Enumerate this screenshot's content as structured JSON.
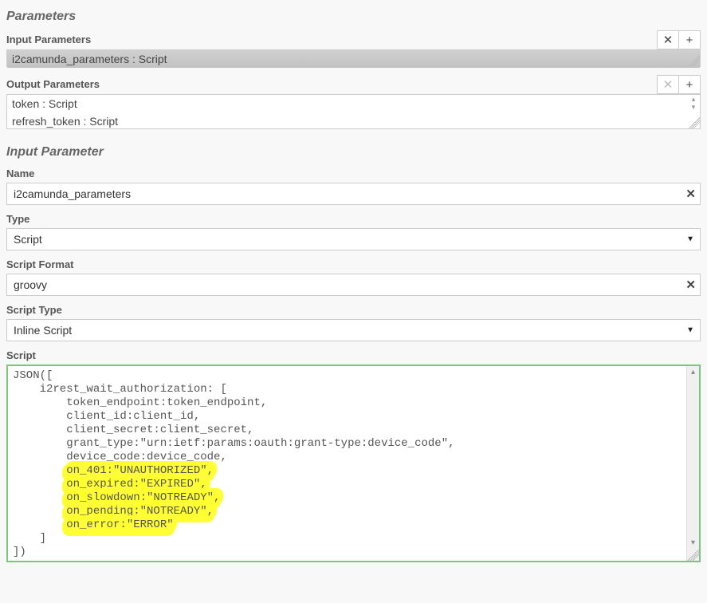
{
  "parameters": {
    "title": "Parameters",
    "input": {
      "label": "Input Parameters",
      "items": [
        "i2camunda_parameters : Script"
      ],
      "selectedIndex": 0,
      "remove_label": "✕",
      "add_label": "+"
    },
    "output": {
      "label": "Output Parameters",
      "items": [
        "token : Script",
        "refresh_token : Script"
      ],
      "remove_label": "✕",
      "add_label": "+"
    }
  },
  "detail": {
    "title": "Input Parameter",
    "name": {
      "label": "Name",
      "value": "i2camunda_parameters"
    },
    "type": {
      "label": "Type",
      "value": "Script"
    },
    "scriptFormat": {
      "label": "Script Format",
      "value": "groovy"
    },
    "scriptType": {
      "label": "Script Type",
      "value": "Inline Script"
    },
    "script": {
      "label": "Script",
      "lines": [
        {
          "indent": 0,
          "text": "JSON(["
        },
        {
          "indent": 1,
          "text": "i2rest_wait_authorization: ["
        },
        {
          "indent": 2,
          "text": "token_endpoint:token_endpoint,"
        },
        {
          "indent": 2,
          "text": "client_id:client_id,"
        },
        {
          "indent": 2,
          "text": "client_secret:client_secret,"
        },
        {
          "indent": 2,
          "text": "grant_type:\"urn:ietf:params:oauth:grant-type:device_code\","
        },
        {
          "indent": 2,
          "text": "device_code:device_code,"
        },
        {
          "indent": 2,
          "text": "on_401:\"UNAUTHORIZED\",",
          "hl": true
        },
        {
          "indent": 2,
          "text": "on_expired:\"EXPIRED\",",
          "hl": true
        },
        {
          "indent": 2,
          "text": "on_slowdown:\"NOTREADY\",",
          "hl": true
        },
        {
          "indent": 2,
          "text": "on_pending:\"NOTREADY\",",
          "hl": true
        },
        {
          "indent": 2,
          "text": "on_error:\"ERROR\"",
          "hl": true
        },
        {
          "indent": 1,
          "text": "]"
        },
        {
          "indent": 0,
          "text": "])"
        }
      ]
    }
  },
  "icons": {
    "clear": "✕",
    "caret": "▼",
    "up": "▴",
    "down": "▾"
  }
}
